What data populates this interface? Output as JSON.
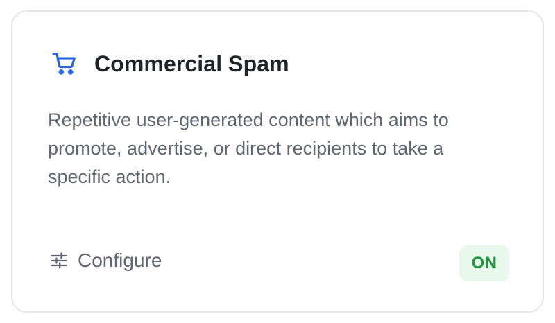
{
  "card": {
    "icon": "shopping-cart-icon",
    "title": "Commercial Spam",
    "description": "Repetitive user-generated content which aims to promote, advertise, or direct recipients to take a specific action.",
    "configure": {
      "icon": "sliders-icon",
      "label": "Configure"
    },
    "status": {
      "label": "ON",
      "enabled": true
    }
  },
  "colors": {
    "accent": "#2563eb",
    "status_text": "#22963e",
    "status_bg": "#e8f8ec",
    "title": "#1f2328",
    "muted_text": "#5f6672",
    "border": "#e5e7eb"
  }
}
